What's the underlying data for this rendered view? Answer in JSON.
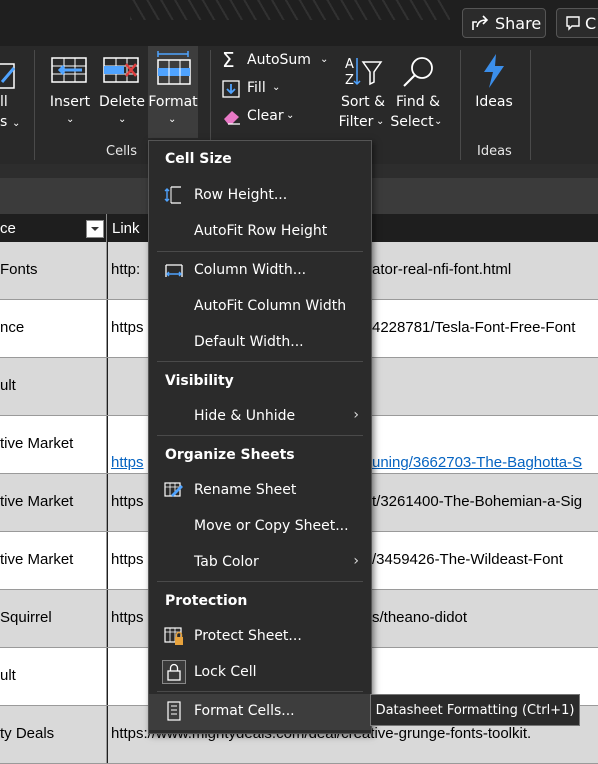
{
  "topbar": {
    "share_label": "Share",
    "comments_label": "C"
  },
  "ribbon": {
    "cells_group": {
      "label": "Cells",
      "insert_label": "Insert",
      "delete_label": "Delete",
      "format_label": "Format",
      "left_partial_top": "ll",
      "left_partial_bottom": "s"
    },
    "editing": {
      "autosum_label": "AutoSum",
      "fill_label": "Fill",
      "clear_label": "Clear",
      "sort_label_1": "Sort &",
      "sort_label_2": "Filter",
      "find_label_1": "Find &",
      "find_label_2": "Select"
    },
    "ideas_group": {
      "label": "Ideas",
      "ideas_label": "Ideas"
    }
  },
  "sheet": {
    "header": {
      "col_a_partial": "ce",
      "col_b_label": "Link"
    },
    "rows": [
      {
        "a": "Fonts",
        "b": "http:",
        "b_right": "ator-real-nfi-font.html",
        "shade": "#d9d9d9"
      },
      {
        "a": "nce",
        "b": "https",
        "b_right": "4228781/Tesla-Font-Free-Font",
        "shade": "#ffffff"
      },
      {
        "a": "ult",
        "b": "",
        "b_right": "",
        "shade": "#d9d9d9"
      },
      {
        "a": "tive Market",
        "b": "https",
        "b_right": "uning/3662703-The-Baghotta-S",
        "shade": "#ffffff",
        "link": true
      },
      {
        "a": "tive Market",
        "b": "https",
        "b_right": "t/3261400-The-Bohemian-a-Sig",
        "shade": "#d9d9d9"
      },
      {
        "a": "tive Market",
        "b": "https",
        "b_right": "/3459426-The-Wildeast-Font",
        "shade": "#ffffff"
      },
      {
        "a": "Squirrel",
        "b": "https",
        "b_right": "s/theano-didot",
        "shade": "#d9d9d9"
      },
      {
        "a": "ult",
        "b": "",
        "b_right": "",
        "shade": "#ffffff"
      },
      {
        "a": "ty Deals",
        "b": "https://www.mightydeals.com/deal/creative-grunge-fonts-toolkit.",
        "b_right": "",
        "shade": "#d9d9d9"
      }
    ]
  },
  "menu": {
    "cell_size_header": "Cell Size",
    "row_height": "Row Height...",
    "autofit_row_height": "AutoFit Row Height",
    "column_width": "Column Width...",
    "autofit_column_width": "AutoFit Column Width",
    "default_width": "Default Width...",
    "visibility_header": "Visibility",
    "hide_unhide": "Hide & Unhide",
    "organize_header": "Organize Sheets",
    "rename_sheet": "Rename Sheet",
    "move_copy_sheet": "Move or Copy Sheet...",
    "tab_color": "Tab Color",
    "protection_header": "Protection",
    "protect_sheet": "Protect Sheet...",
    "lock_cell": "Lock Cell",
    "format_cells": "Format Cells..."
  },
  "tooltip": {
    "text": "Datasheet Formatting (Ctrl+1)"
  },
  "colors": {
    "accent_blue": "#4fa3ff",
    "ideas_blue": "#3b8eea",
    "highlight": "#3d3d3d"
  }
}
